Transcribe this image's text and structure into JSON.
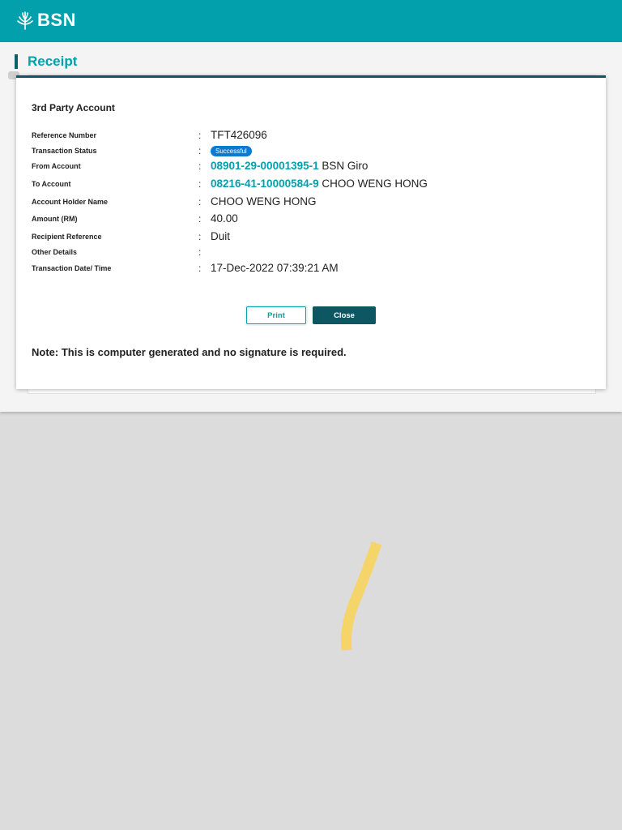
{
  "header": {
    "brand": "BSN",
    "brand_color": "#02a0ad"
  },
  "page": {
    "title": "Receipt"
  },
  "receipt": {
    "section_title": "3rd Party Account",
    "rows": [
      {
        "label": "Reference Number",
        "value": "TFT426096"
      },
      {
        "label": "Transaction Status",
        "value": "Successful"
      },
      {
        "label": "From Account",
        "account": "08901-29-00001395-1",
        "value": "BSN Giro"
      },
      {
        "label": "To Account",
        "account": "08216-41-10000584-9",
        "value": "CHOO WENG HONG"
      },
      {
        "label": "Account Holder Name",
        "value": "CHOO WENG HONG"
      },
      {
        "label": "Amount (RM)",
        "value": "40.00"
      },
      {
        "label": "Recipient Reference",
        "value": "Duit"
      },
      {
        "label": "Other Details",
        "value": ""
      },
      {
        "label": "Transaction Date/ Time",
        "value": "17-Dec-2022 07:39:21 AM"
      }
    ],
    "colon": ":",
    "buttons": {
      "print": "Print",
      "close": "Close"
    },
    "note": "Note: This is computer generated and no signature is required."
  },
  "colors": {
    "accent": "#02a0ad",
    "dark": "#0d5662",
    "badge": "#0a7bd1",
    "scribble": "#f5d46a"
  },
  "icons": {
    "logo": "bsn-tree-icon"
  }
}
